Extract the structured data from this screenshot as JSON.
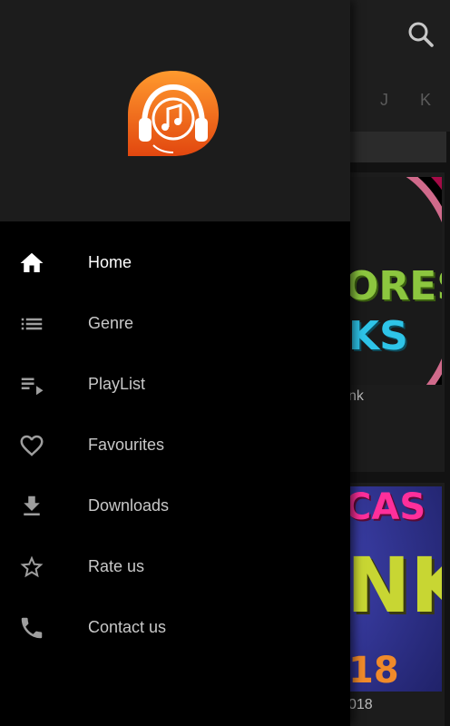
{
  "app": {
    "alphabet_visible": [
      "J",
      "K"
    ],
    "cards": [
      {
        "caption": "nk",
        "cover_text": [
          "ORES",
          "KS"
        ]
      },
      {
        "caption": "018",
        "cover_text": [
          "CAS",
          "NK",
          "18"
        ]
      }
    ]
  },
  "drawer": {
    "logo_icon": "headphones-music-icon",
    "items": [
      {
        "label": "Home",
        "icon": "home-icon",
        "active": true
      },
      {
        "label": "Genre",
        "icon": "list-icon",
        "active": false
      },
      {
        "label": "PlayList",
        "icon": "playlist-icon",
        "active": false
      },
      {
        "label": "Favourites",
        "icon": "heart-icon",
        "active": false
      },
      {
        "label": "Downloads",
        "icon": "download-icon",
        "active": false
      },
      {
        "label": "Rate us",
        "icon": "star-icon",
        "active": false
      },
      {
        "label": "Contact us",
        "icon": "phone-icon",
        "active": false
      }
    ]
  },
  "colors": {
    "accent": "#f26522",
    "drawer_bg": "#000000",
    "header_bg": "#1c1c1c",
    "text_active": "#ffffff",
    "text_inactive": "#c8c8c8"
  }
}
